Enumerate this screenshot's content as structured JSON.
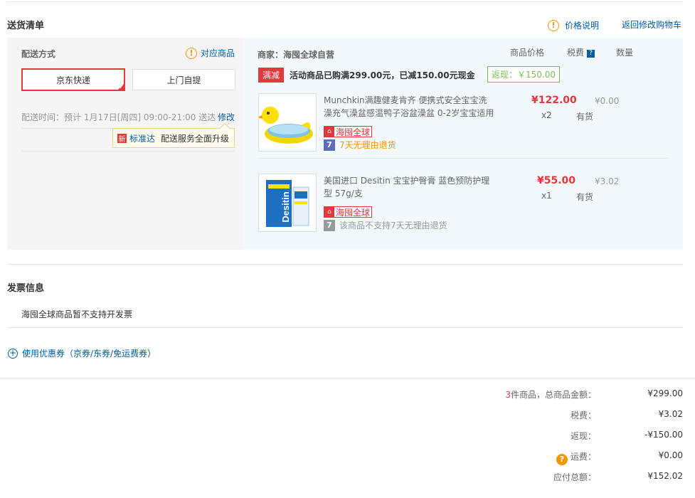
{
  "header": {
    "title": "送货清单",
    "price_note": "价格说明",
    "back_to_cart": "返回修改购物车"
  },
  "shipping": {
    "label": "配送方式",
    "match_items": "对应商品",
    "options": [
      "京东快递",
      "上门自提"
    ],
    "selected": "京东快递",
    "time_text": "配送时间：预计 1月17日[周四] 09:00-21:00 送达",
    "edit": "修改",
    "tip_badge": "新",
    "tip_link": "标准达",
    "tip_text": "配送服务全面升级"
  },
  "merchant": {
    "label": "商家：海囤全球自营",
    "col_price": "商品价格",
    "col_tax": "税费",
    "col_qty": "数量",
    "promo_tag": "满减",
    "promo_text": "活动商品已购满299.00元，已减150.00元现金",
    "cashback": "返现：￥150.00"
  },
  "items": [
    {
      "name": "Munchkin满趣健麦肯齐 便携式安全宝宝洗澡充气澡盆感温鸭子浴盆澡盆 0-2岁宝宝适用",
      "price": "¥122.00",
      "tax": "¥0.00",
      "qty": "x2",
      "stock": "有货",
      "global_tag": "海囤全球",
      "return_text": "7天无理由退货",
      "return_color": "#f39800",
      "image": "yellow-duck-bathtub"
    },
    {
      "name": "美国进口 Desitin 宝宝护臀膏 蓝色预防护理型 57g/支",
      "price": "¥55.00",
      "tax": "¥3.02",
      "qty": "x1",
      "stock": "有货",
      "global_tag": "海囤全球",
      "return_text": "该商品不支持7天无理由退货",
      "return_color": "#999999",
      "image": "desitin-cream",
      "product_brand": "Desitin"
    }
  ],
  "invoice": {
    "title": "发票信息",
    "text": "海囤全球商品暂不支持开发票"
  },
  "coupon": {
    "text": "使用优惠券（京券/东券/免运费券）"
  },
  "summary": {
    "count": "3",
    "count_suffix": "件商品，总商品金额：",
    "total": "¥299.00",
    "tax_label": "税费：",
    "tax": "¥3.02",
    "cashback_label": "返现：",
    "cashback": "-¥150.00",
    "freight_label": "运费：",
    "freight": "¥0.00",
    "payable_label": "应付总额：",
    "payable": "¥152.02"
  },
  "colors": {
    "accent": "#e4393c",
    "link": "#005ea7",
    "warning": "#f39800",
    "cashback": "#7abd54"
  }
}
